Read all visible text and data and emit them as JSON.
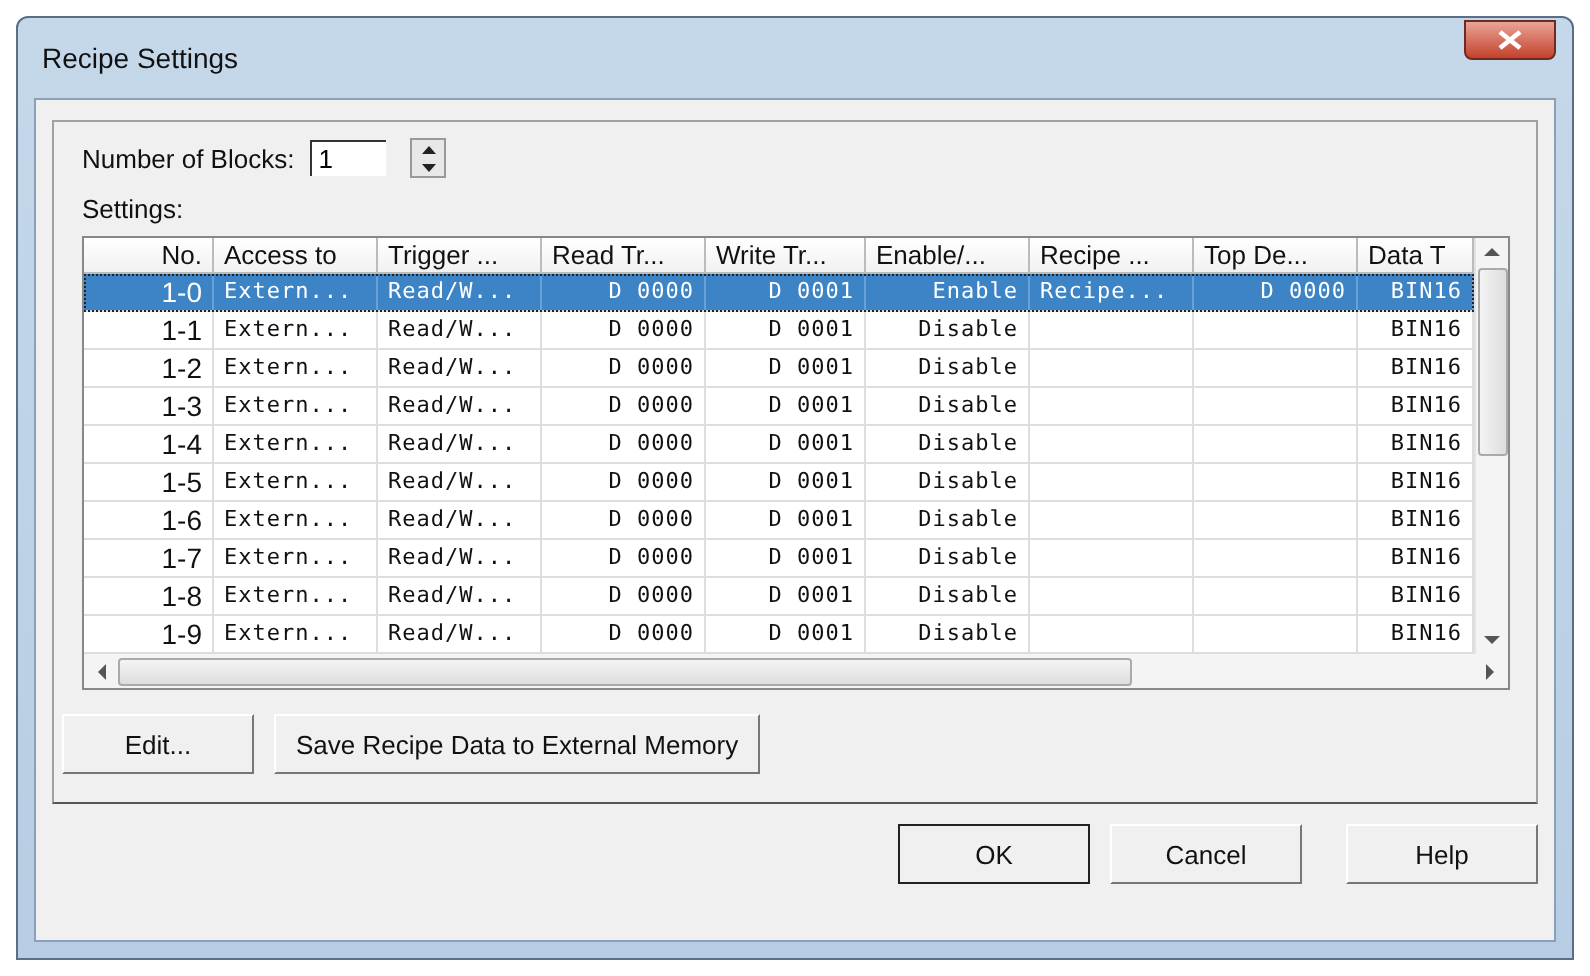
{
  "window": {
    "title": "Recipe Settings"
  },
  "blocks": {
    "label": "Number of Blocks:",
    "value": "1"
  },
  "settings_label": "Settings:",
  "table": {
    "columns": [
      "No.",
      "Access to",
      "Trigger ...",
      "Read Tr...",
      "Write Tr...",
      "Enable/...",
      "Recipe ...",
      "Top De...",
      "Data T"
    ],
    "rows": [
      {
        "selected": true,
        "cells": [
          "1-0",
          "Extern...",
          "Read/W...",
          "D 0000",
          "D 0001",
          "Enable",
          "Recipe...",
          "D 0000",
          "BIN16"
        ]
      },
      {
        "selected": false,
        "cells": [
          "1-1",
          "Extern...",
          "Read/W...",
          "D 0000",
          "D 0001",
          "Disable",
          "",
          "",
          "BIN16"
        ]
      },
      {
        "selected": false,
        "cells": [
          "1-2",
          "Extern...",
          "Read/W...",
          "D 0000",
          "D 0001",
          "Disable",
          "",
          "",
          "BIN16"
        ]
      },
      {
        "selected": false,
        "cells": [
          "1-3",
          "Extern...",
          "Read/W...",
          "D 0000",
          "D 0001",
          "Disable",
          "",
          "",
          "BIN16"
        ]
      },
      {
        "selected": false,
        "cells": [
          "1-4",
          "Extern...",
          "Read/W...",
          "D 0000",
          "D 0001",
          "Disable",
          "",
          "",
          "BIN16"
        ]
      },
      {
        "selected": false,
        "cells": [
          "1-5",
          "Extern...",
          "Read/W...",
          "D 0000",
          "D 0001",
          "Disable",
          "",
          "",
          "BIN16"
        ]
      },
      {
        "selected": false,
        "cells": [
          "1-6",
          "Extern...",
          "Read/W...",
          "D 0000",
          "D 0001",
          "Disable",
          "",
          "",
          "BIN16"
        ]
      },
      {
        "selected": false,
        "cells": [
          "1-7",
          "Extern...",
          "Read/W...",
          "D 0000",
          "D 0001",
          "Disable",
          "",
          "",
          "BIN16"
        ]
      },
      {
        "selected": false,
        "cells": [
          "1-8",
          "Extern...",
          "Read/W...",
          "D 0000",
          "D 0001",
          "Disable",
          "",
          "",
          "BIN16"
        ]
      },
      {
        "selected": false,
        "cells": [
          "1-9",
          "Extern...",
          "Read/W...",
          "D 0000",
          "D 0001",
          "Disable",
          "",
          "",
          "BIN16"
        ]
      }
    ]
  },
  "panel_buttons": [
    "Edit...",
    "Save Recipe Data to External Memory"
  ],
  "dialog_buttons": [
    {
      "label": "OK",
      "default": true
    },
    {
      "label": "Cancel",
      "default": false
    },
    {
      "label": "Help",
      "default": false
    }
  ]
}
